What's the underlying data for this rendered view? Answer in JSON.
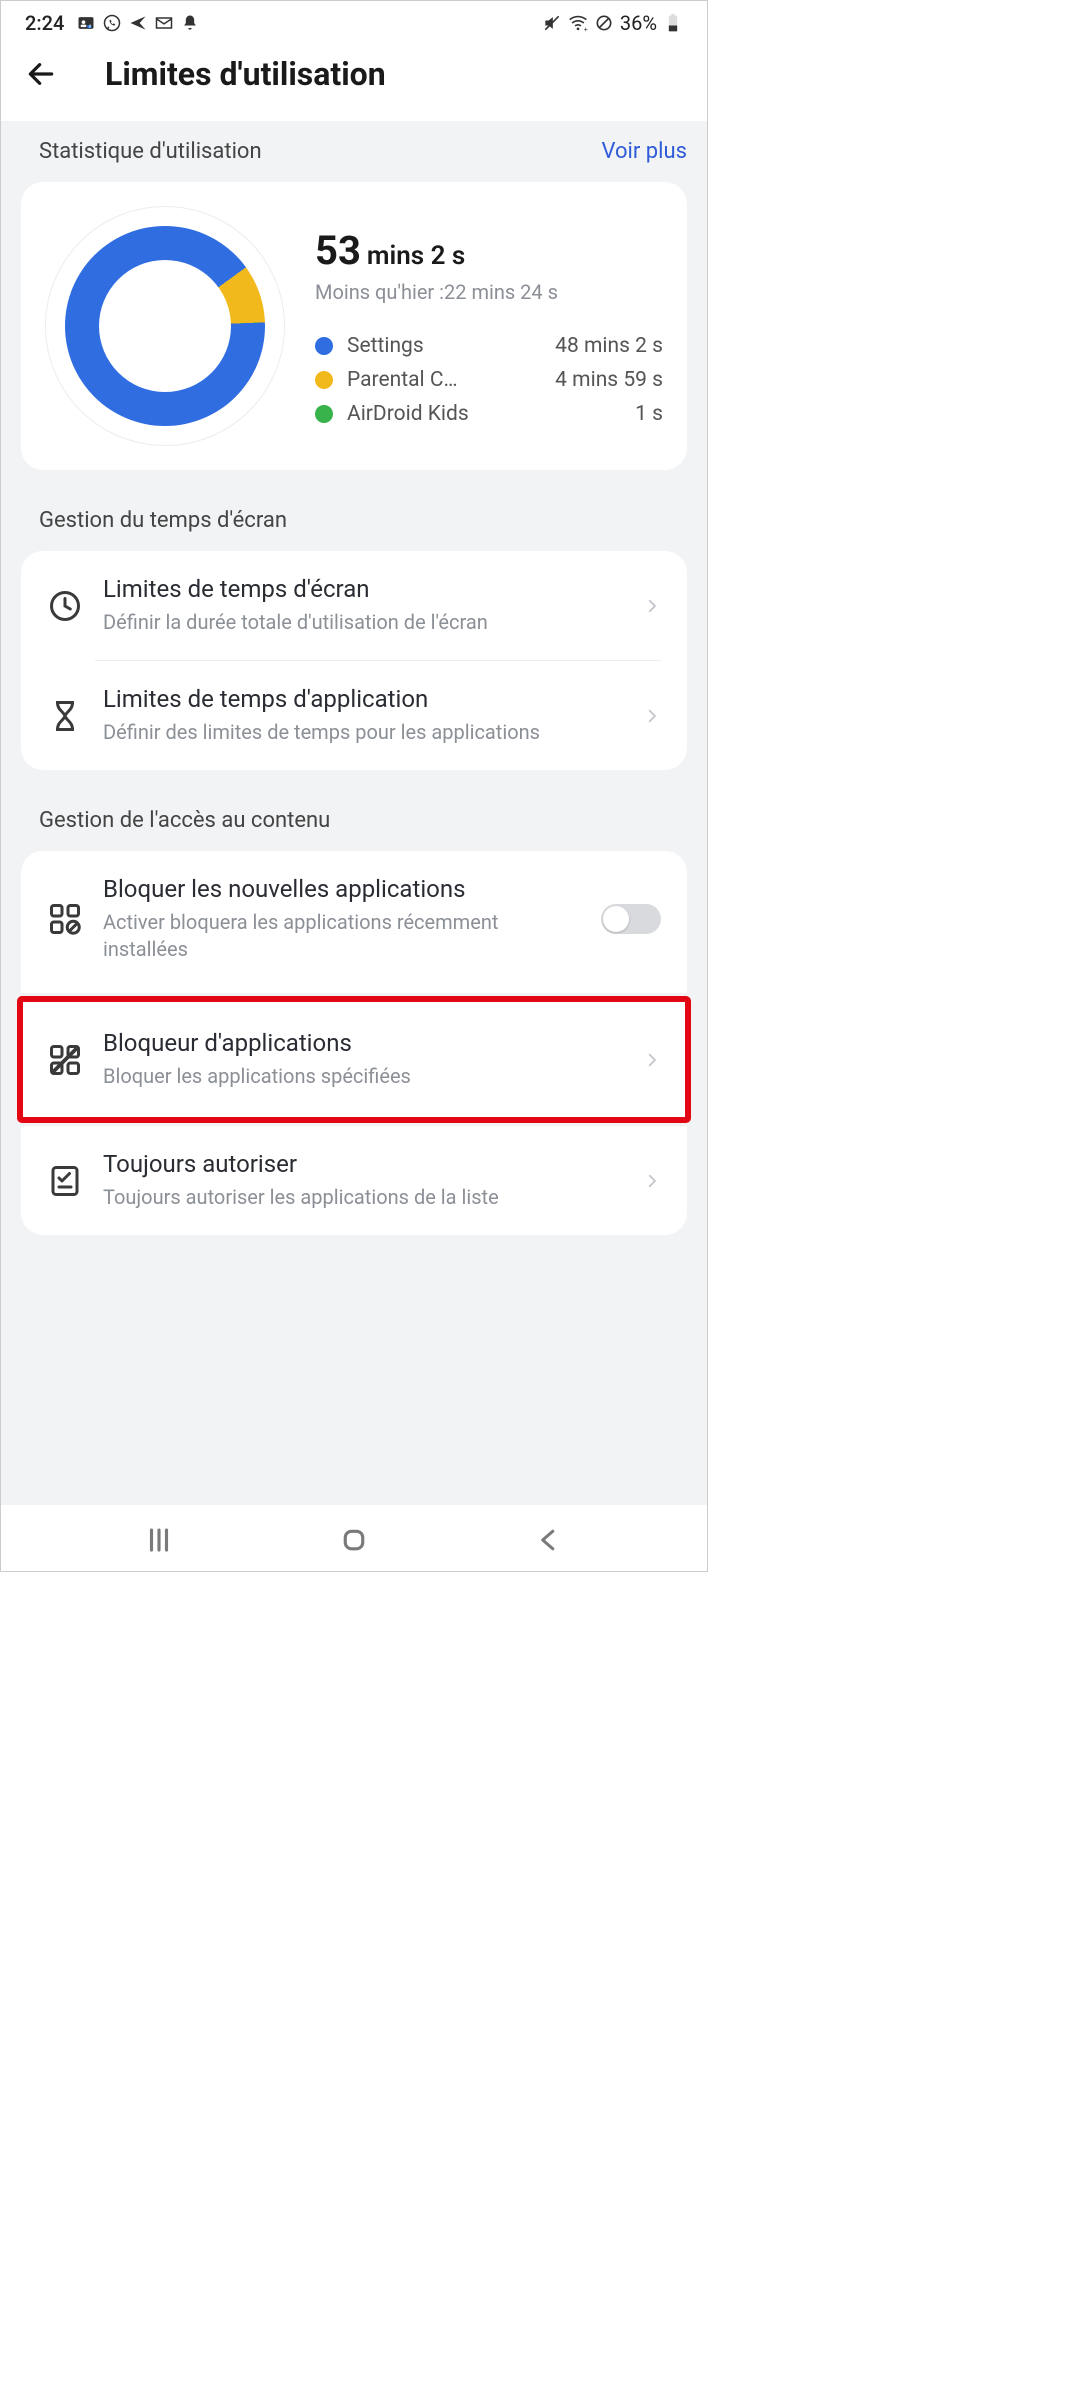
{
  "status": {
    "time": "2:24",
    "battery_pct": "36%"
  },
  "header": {
    "title": "Limites d'utilisation"
  },
  "usage_stats": {
    "section_label": "Statistique d'utilisation",
    "see_more": "Voir plus",
    "total_primary": "53",
    "total_secondary": "mins 2 s",
    "compare": "Moins qu'hier :22 mins 24 s",
    "apps": [
      {
        "name": "Settings",
        "time": "48 mins 2 s",
        "color": "#2f6de1"
      },
      {
        "name": "Parental C…",
        "time": "4 mins 59 s",
        "color": "#f2b91d"
      },
      {
        "name": "AirDroid Kids",
        "time": "1 s",
        "color": "#38b24a"
      }
    ]
  },
  "chart_data": {
    "type": "pie",
    "title": "",
    "categories": [
      "Settings",
      "Parental C…",
      "AirDroid Kids"
    ],
    "values": [
      2882,
      299,
      1
    ],
    "colors": [
      "#2f6de1",
      "#f2b91d",
      "#38b24a"
    ],
    "unit": "seconds"
  },
  "screen_time": {
    "section_label": "Gestion du temps d'écran",
    "items": [
      {
        "title": "Limites de temps d'écran",
        "sub": "Définir la durée totale d'utilisation de l'écran"
      },
      {
        "title": "Limites de temps d'application",
        "sub": "Définir des limites de temps pour les applications"
      }
    ]
  },
  "content_access": {
    "section_label": "Gestion de l'accès au contenu",
    "block_new": {
      "title": "Bloquer les nouvelles applications",
      "sub": "Activer bloquera les applications récemment installées",
      "enabled": false
    },
    "app_blocker": {
      "title": "Bloqueur d'applications",
      "sub": "Bloquer les applications spécifiées"
    },
    "always_allow": {
      "title": "Toujours autoriser",
      "sub": "Toujours autoriser les applications de la liste"
    }
  }
}
